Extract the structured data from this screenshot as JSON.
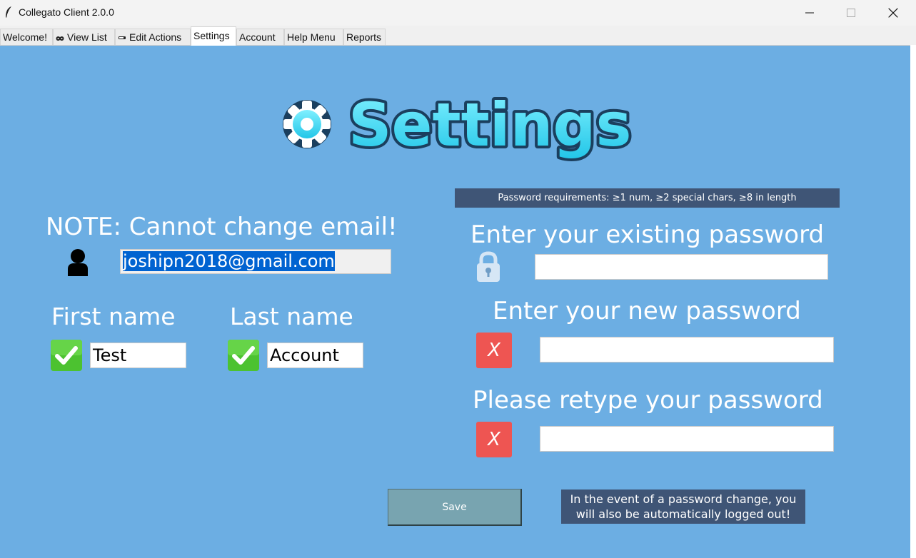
{
  "window": {
    "title": "Collegato Client 2.0.0",
    "app_icon": "feather-icon"
  },
  "tabs": [
    {
      "label": "Welcome!",
      "icon": null
    },
    {
      "label": "View List",
      "icon": "eyes-icon"
    },
    {
      "label": "Edit Actions",
      "icon": "pencil-icon"
    },
    {
      "label": "Settings",
      "icon": null,
      "active": true
    },
    {
      "label": "Account",
      "icon": null
    },
    {
      "label": "Help Menu",
      "icon": null
    },
    {
      "label": "Reports",
      "icon": null
    }
  ],
  "logo": {
    "text": "Settings",
    "icon": "gear-icon"
  },
  "password_requirements": "Password requirements: ≥1 num, ≥2 special chars, ≥8 in length",
  "left": {
    "email_note": "NOTE: Cannot change email!",
    "email_value": "joshipn2018@gmail.com",
    "first_name_label": "First name",
    "first_name_value": "Test",
    "last_name_label": "Last name",
    "last_name_value": "Account"
  },
  "right": {
    "existing_label": "Enter your existing password",
    "new_label": "Enter your new password",
    "retype_label": "Please retype your password",
    "new_status": "X",
    "retype_status": "X"
  },
  "save_label": "Save",
  "logout_note_line1": "In the event of a password change, you",
  "logout_note_line2": "will also be automatically logged out!",
  "colors": {
    "background": "#6caee3",
    "dark_banner": "#3f5576",
    "error_red": "#ee5552",
    "check_green": "#4cc230",
    "save_button": "#78a4b0"
  }
}
